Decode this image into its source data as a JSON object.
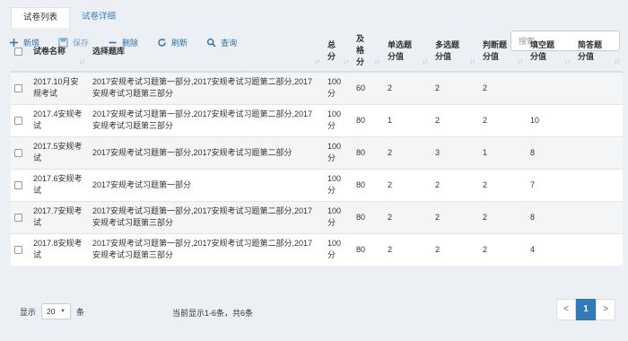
{
  "tabs": [
    {
      "label": "试卷列表",
      "active": true
    },
    {
      "label": "试卷详细",
      "active": false
    }
  ],
  "toolbar": {
    "add_label": "新增",
    "save_label": "保存",
    "delete_label": "删除",
    "refresh_label": "刷新",
    "query_label": "查询",
    "search_placeholder": "搜索"
  },
  "table": {
    "headers": {
      "name": "试卷名称",
      "bank": "选择题库",
      "total": "总分",
      "pass": "及格分",
      "single": "单选题分值",
      "multi": "多选题分值",
      "judge": "判断题分值",
      "blank": "填空题分值",
      "short": "简答题分值"
    },
    "rows": [
      {
        "name": "2017.10月安规考试",
        "bank": "2017安规考试习题第一部分,2017安规考试习题第二部分,2017安规考试习题第三部分",
        "total": "100分",
        "pass": "60",
        "single": "2",
        "multi": "2",
        "judge": "2",
        "blank": "",
        "short": ""
      },
      {
        "name": "2017.4安规考试",
        "bank": "2017安规考试习题第一部分,2017安规考试习题第二部分,2017安规考试习题第三部分",
        "total": "100分",
        "pass": "80",
        "single": "1",
        "multi": "2",
        "judge": "2",
        "blank": "10",
        "short": ""
      },
      {
        "name": "2017.5安规考试",
        "bank": "2017安规考试习题第一部分,2017安规考试习题第二部分",
        "total": "100分",
        "pass": "80",
        "single": "2",
        "multi": "3",
        "judge": "1",
        "blank": "8",
        "short": ""
      },
      {
        "name": "2017.6安规考试",
        "bank": "2017安规考试习题第一部分",
        "total": "100分",
        "pass": "80",
        "single": "2",
        "multi": "2",
        "judge": "2",
        "blank": "7",
        "short": ""
      },
      {
        "name": "2017.7安规考试",
        "bank": "2017安规考试习题第一部分,2017安规考试习题第二部分,2017安规考试习题第三部分",
        "total": "100分",
        "pass": "80",
        "single": "2",
        "multi": "2",
        "judge": "2",
        "blank": "8",
        "short": ""
      },
      {
        "name": "2017.8安规考试",
        "bank": "2017安规考试习题第一部分,2017安规考试习题第二部分,2017安规考试习题第三部分",
        "total": "100分",
        "pass": "80",
        "single": "2",
        "multi": "2",
        "judge": "2",
        "blank": "4",
        "short": ""
      }
    ]
  },
  "footer": {
    "show_label": "显示",
    "page_size": "20",
    "unit_label": "条",
    "page_info": "当前显示1-6条，共6条",
    "prev": "<",
    "current_page": "1",
    "next": ">"
  },
  "colors": {
    "accent": "#337ab7",
    "toolbar_text": "#2f6ea8",
    "background": "#eceff3",
    "row_alt": "#f4f5f7"
  },
  "icons": {
    "add": "plus-icon",
    "save": "save-icon",
    "delete": "minus-icon",
    "refresh": "refresh-icon",
    "query": "search-icon",
    "sort": "sort-icon",
    "page_size_caret": "caret-down-icon"
  }
}
